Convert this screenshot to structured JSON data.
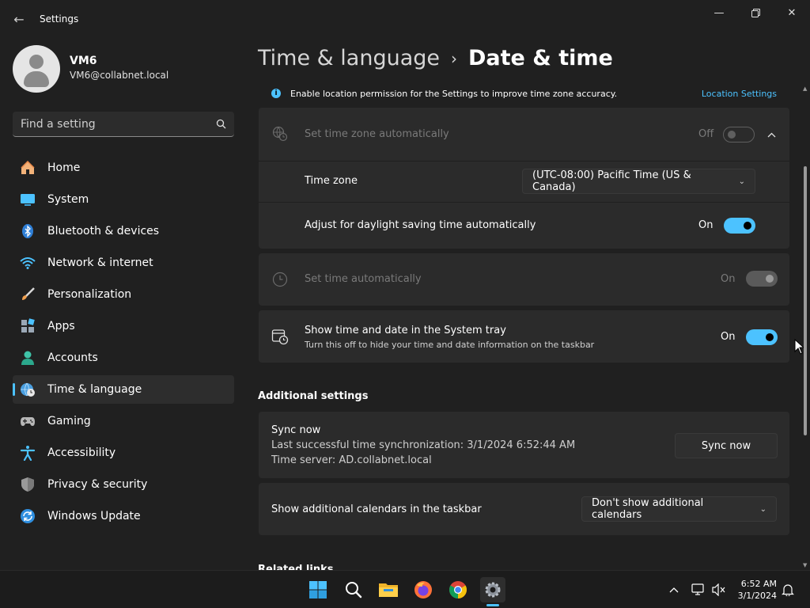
{
  "window": {
    "title": "Settings"
  },
  "profile": {
    "name": "VM6",
    "email": "VM6@collabnet.local"
  },
  "search": {
    "placeholder": "Find a setting"
  },
  "nav": [
    {
      "label": "Home"
    },
    {
      "label": "System"
    },
    {
      "label": "Bluetooth & devices"
    },
    {
      "label": "Network & internet"
    },
    {
      "label": "Personalization"
    },
    {
      "label": "Apps"
    },
    {
      "label": "Accounts"
    },
    {
      "label": "Time & language"
    },
    {
      "label": "Gaming"
    },
    {
      "label": "Accessibility"
    },
    {
      "label": "Privacy & security"
    },
    {
      "label": "Windows Update"
    }
  ],
  "breadcrumb": {
    "parent": "Time & language",
    "current": "Date & time"
  },
  "info": {
    "text": "Enable location permission for the Settings to improve time zone accuracy.",
    "link": "Location Settings"
  },
  "settings": {
    "tz_auto": {
      "title": "Set time zone automatically",
      "state": "Off"
    },
    "time_zone": {
      "title": "Time zone",
      "value": "(UTC-08:00) Pacific Time (US & Canada)"
    },
    "dst": {
      "title": "Adjust for daylight saving time automatically",
      "state": "On"
    },
    "time_auto": {
      "title": "Set time automatically",
      "state": "On"
    },
    "tray": {
      "title": "Show time and date in the System tray",
      "subtitle": "Turn this off to hide your time and date information on the taskbar",
      "state": "On"
    }
  },
  "additional": {
    "title": "Additional settings",
    "sync": {
      "title": "Sync now",
      "last": "Last successful time synchronization: 3/1/2024 6:52:44 AM",
      "server": "Time server: AD.collabnet.local",
      "button": "Sync now"
    },
    "calendars": {
      "title": "Show additional calendars in the taskbar",
      "value": "Don't show additional calendars"
    }
  },
  "related": {
    "title": "Related links"
  },
  "taskbar": {
    "time": "6:52 AM",
    "date": "3/1/2024"
  },
  "colors": {
    "accent": "#4cc2ff",
    "background": "#202020",
    "card": "#2b2b2b"
  }
}
